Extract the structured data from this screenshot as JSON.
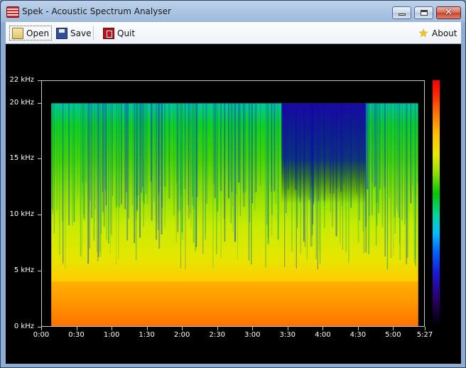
{
  "window": {
    "title": "Spek - Acoustic Spectrum Analyser"
  },
  "window_controls": {
    "close_glyph": "✕"
  },
  "toolbar": {
    "open_label": "Open",
    "save_label": "Save",
    "quit_label": "Quit",
    "about_label": "About",
    "icons": {
      "open": "folder-icon",
      "save": "floppy-icon",
      "quit": "exit-icon",
      "about": "star-icon"
    }
  },
  "spectrogram": {
    "y_labels": [
      "22 kHz",
      "20 kHz",
      "15 kHz",
      "10 kHz",
      "5 kHz",
      "0 kHz"
    ],
    "x_labels": [
      "0:00",
      "0:30",
      "1:00",
      "1:30",
      "2:00",
      "2:30",
      "3:00",
      "3:30",
      "4:00",
      "4:30",
      "5:00",
      "5:27"
    ],
    "y_values_khz": [
      22,
      20,
      15,
      10,
      5,
      0
    ],
    "x_values_seconds": [
      0,
      30,
      60,
      90,
      120,
      150,
      180,
      210,
      240,
      270,
      300,
      327
    ],
    "duration_seconds": 327,
    "max_frequency_khz": 22,
    "content_cutoff_khz": 20,
    "colormap": [
      "#000000",
      "#2b0070",
      "#1a1ad8",
      "#00c0ff",
      "#00c800",
      "#e8e800",
      "#ff7000",
      "#ff0000"
    ]
  }
}
